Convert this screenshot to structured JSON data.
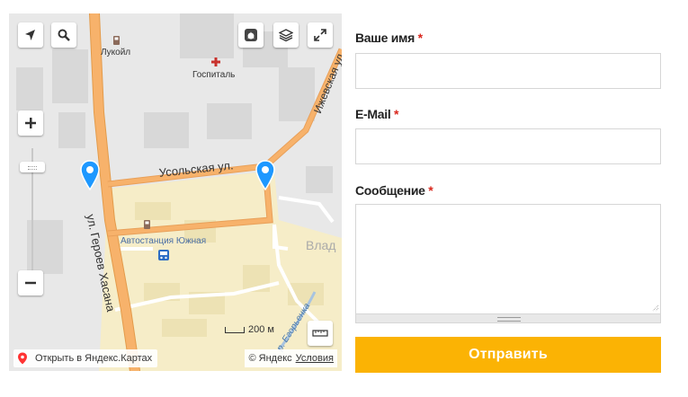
{
  "map": {
    "labels": {
      "street_usolskaya": "Усольская ул.",
      "street_geroev_khasana": "ул. Героев Хасана",
      "street_izhevskaya": "Ижевская ул",
      "river_zaryanka": "р. Егорьенка",
      "district_partial": "Влад",
      "poi_lukoil": "Лукойл",
      "poi_hospital": "Госпиталь",
      "poi_bus_station": "Автостанция Южная"
    },
    "controls": {
      "zoom_level": 0.89
    },
    "scale_label": "200 м",
    "open_link": "Открыть в Яндекс.Картах",
    "copyright": "© Яндекс",
    "terms": "Условия",
    "colors": {
      "main_road": "#f7b26b",
      "residential": "#f6edc8",
      "industrial": "#e4e4e4",
      "pin": "#1e98ff",
      "river": "#a8c4e0"
    },
    "icons": [
      "location-arrow-icon",
      "search-icon",
      "traffic-icon",
      "layers-icon",
      "fullscreen-icon",
      "zoom-in-icon",
      "zoom-out-icon",
      "ruler-icon",
      "map-pin-icon",
      "fuel-icon",
      "hospital-icon",
      "bus-icon"
    ]
  },
  "form": {
    "name_label": "Ваше имя",
    "email_label": "E-Mail",
    "message_label": "Сообщение",
    "required_mark": "*",
    "name_value": "",
    "email_value": "",
    "message_value": "",
    "submit_label": "Отправить",
    "accent_color": "#fbb304"
  }
}
